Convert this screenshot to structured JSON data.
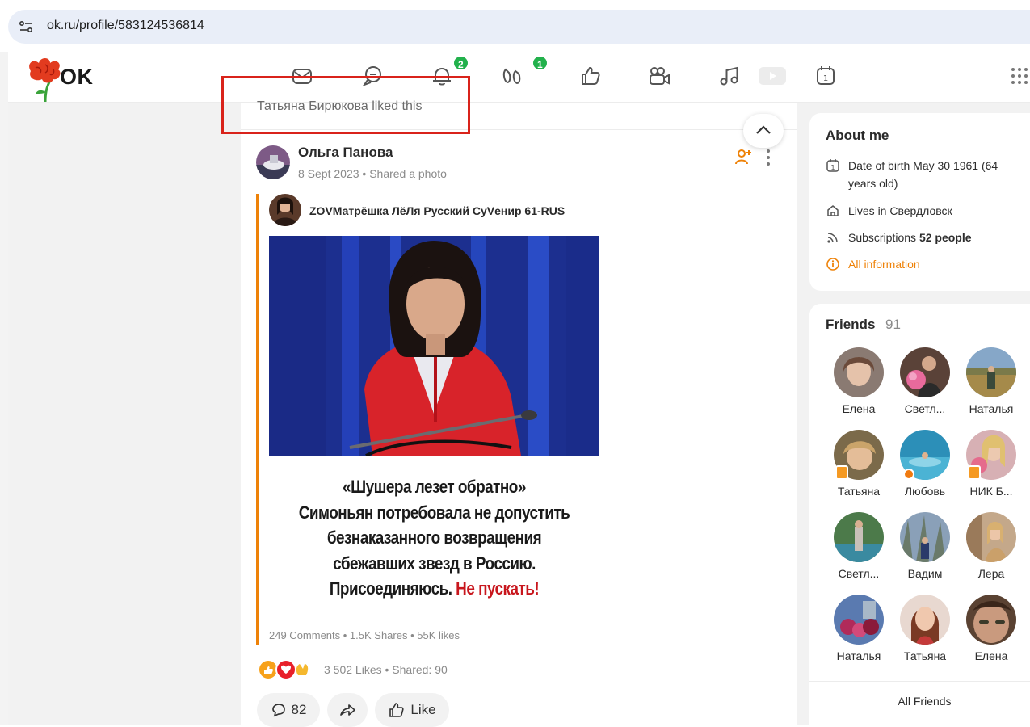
{
  "browser": {
    "url": "ok.ru/profile/583124536814"
  },
  "app": {
    "logo_text": "OK"
  },
  "nav": {
    "items": [
      {
        "name": "messages-icon",
        "badge": ""
      },
      {
        "name": "discussions-icon",
        "badge": ""
      },
      {
        "name": "notifications-icon",
        "badge": "2"
      },
      {
        "name": "guests-icon",
        "badge": "1"
      },
      {
        "name": "events-icon",
        "badge": ""
      },
      {
        "name": "video-icon",
        "badge": ""
      },
      {
        "name": "music-icon",
        "badge": ""
      },
      {
        "name": "live-icon",
        "badge": ""
      },
      {
        "name": "calendar-icon",
        "badge": ""
      },
      {
        "name": "apps-grid-icon",
        "badge": ""
      }
    ]
  },
  "feed": {
    "liked_by": "Татьяна Бирюкова liked this",
    "post": {
      "author": "Ольга Панова",
      "meta": "8 Sept 2023 • Shared a photo",
      "original_author": "ZOVМатрёшка ЛёЛя Русский СуVенир 61-RUS",
      "caption_lines": [
        "«Шушера лезет обратно»",
        "Симоньян потребовала не допустить",
        "безнаказанного возвращения",
        "сбежавших звезд в Россию."
      ],
      "caption_last_prefix": "Присоединяюсь. ",
      "caption_last_red": "Не пускать!",
      "original_stats": "249 Comments  •  1.5K Shares  •  55K likes",
      "likes_stats": "3 502 Likes  •  Shared: 90",
      "comment_count": "82",
      "like_label": "Like"
    }
  },
  "about": {
    "title": "About me",
    "birth": "Date of birth May 30 1961 (64 years old)",
    "lives": "Lives in Свердловск",
    "subscriptions_prefix": "Subscriptions ",
    "subscriptions_count": "52 people",
    "all_info": "All information"
  },
  "friends": {
    "title": "Friends",
    "count": "91",
    "list": [
      {
        "name": "Елена"
      },
      {
        "name": "Светл..."
      },
      {
        "name": "Наталья"
      },
      {
        "name": "Татьяна"
      },
      {
        "name": "Любовь"
      },
      {
        "name": "НИК Б..."
      },
      {
        "name": "Светл..."
      },
      {
        "name": "Вадим"
      },
      {
        "name": "Лера"
      },
      {
        "name": "Наталья"
      },
      {
        "name": "Татьяна"
      },
      {
        "name": "Елена"
      }
    ],
    "all_label": "All Friends"
  },
  "colors": {
    "accent": "#ee8208",
    "badge": "#22b14c",
    "highlight_box": "#d9231b",
    "caption_red": "#c8161d"
  }
}
